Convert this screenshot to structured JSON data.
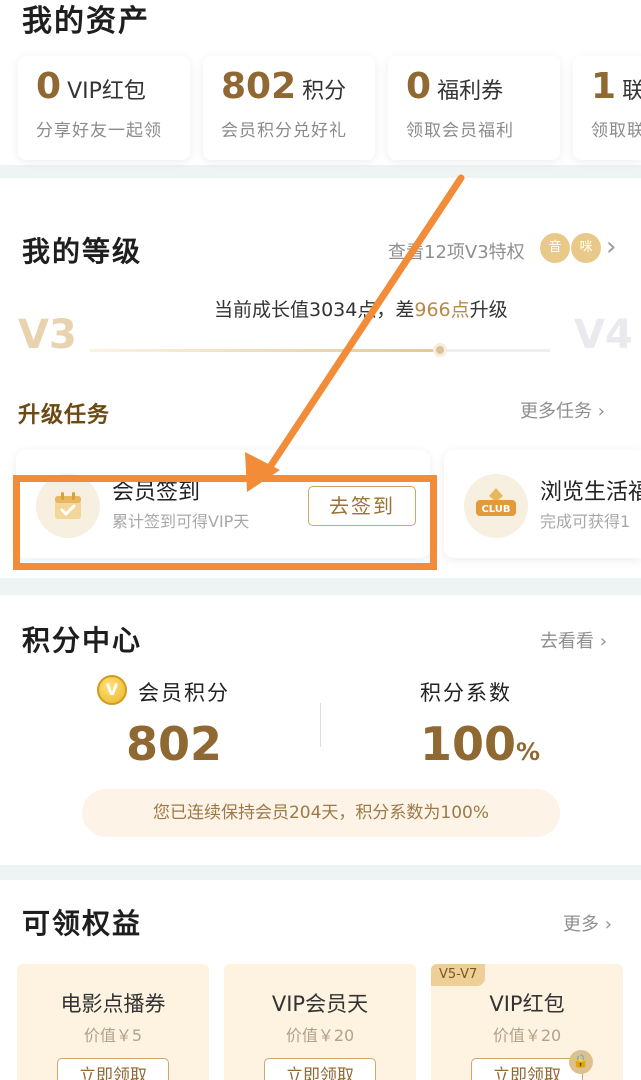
{
  "assets": {
    "title": "我的资产",
    "cards": [
      {
        "num": "0",
        "unit": "VIP红包",
        "sub": "分享好友一起领"
      },
      {
        "num": "802",
        "unit": "积分",
        "sub": "会员积分兑好礼"
      },
      {
        "num": "0",
        "unit": "福利券",
        "sub": "领取会员福利"
      },
      {
        "num": "1",
        "unit": "联",
        "sub": "领取联"
      }
    ]
  },
  "level": {
    "title": "我的等级",
    "privilege_link": "查看12项V3特权",
    "badges": [
      "音",
      "咪"
    ],
    "growth_prefix": "当前成长值3034点，差",
    "growth_gap": "966点",
    "growth_suffix": "升级",
    "current_level": "V3",
    "next_level": "V4",
    "progress": 0.76,
    "tasks_title": "升级任务",
    "tasks_more": "更多任务",
    "tasks": [
      {
        "name": "会员签到",
        "desc": "累计签到可得VIP天",
        "button": "去签到"
      },
      {
        "name": "浏览生活福",
        "desc": "完成可获得1",
        "badge": "CLUB"
      }
    ]
  },
  "points": {
    "title": "积分中心",
    "link": "去看看",
    "coin": "V",
    "label": "会员积分",
    "value": "802",
    "coef_label": "积分系数",
    "coef_value": "100",
    "coef_unit": "%",
    "note": "您已连续保持会员204天，积分系数为100%"
  },
  "benefits": {
    "title": "可领权益",
    "more": "更多",
    "items": [
      {
        "tag": "",
        "name": "电影点播券",
        "price": "价值￥5",
        "button": "立即领取"
      },
      {
        "tag": "",
        "name": "VIP会员天",
        "price": "价值￥20",
        "button": "立即领取"
      },
      {
        "tag": "V5-V7",
        "name": "VIP红包",
        "price": "价值￥20",
        "button": "立即领取"
      }
    ]
  },
  "annotation_color": "#f28c38",
  "accent_color": "#8f6832"
}
